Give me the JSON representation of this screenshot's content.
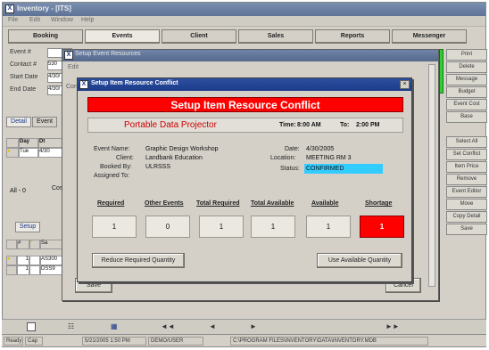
{
  "main_window": {
    "title": "Inventory - [ITS]",
    "menu": [
      "File",
      "Edit",
      "Window",
      "Help"
    ],
    "tabs": [
      "Booking",
      "Events",
      "Client",
      "Sales",
      "Reports",
      "Messenger"
    ],
    "active_tab": "Events",
    "fields": [
      {
        "label": "Event #",
        "value": ""
      },
      {
        "label": "Contact #",
        "value": "530"
      },
      {
        "label": "Start Date",
        "value": "4/30/"
      },
      {
        "label": "End Date",
        "value": "4/30/"
      }
    ],
    "side_buttons": [
      "Print",
      "Delete",
      "Message",
      "Budget",
      "Event Cost",
      "Base",
      "Select All",
      "Set Conflict",
      "Item Price",
      "Remove",
      "Event Editor",
      "Move",
      "Copy Detail",
      "Save"
    ],
    "subtabs": [
      "Detail",
      "Event"
    ],
    "active_subtab": "Detail",
    "grid_headers": [
      "Day",
      "Dt"
    ],
    "grid_rows": [
      [
        "Tue",
        "4/30"
      ]
    ],
    "lower_tab": "Setup",
    "lower_grid_headers": [
      "#",
      "*",
      "Sa"
    ],
    "lower_grid_rows": [
      [
        "1",
        "",
        "AS300"
      ],
      [
        "1",
        "",
        "DSS9"
      ]
    ],
    "side_label": "Cos",
    "left_label": "All - 0"
  },
  "background_dialog": {
    "title": "Setup Event Resources",
    "menu": "Edit",
    "left_label": "Conf"
  },
  "conflict_dialog": {
    "window_title": "Setup Item Resource Conflict",
    "header": "Setup Item Resource Conflict",
    "item_name": "Portable Data Projector",
    "time_label": "Time:",
    "time_from": "8:00 AM",
    "time_to_label": "To:",
    "time_to": "2:00 PM",
    "details_left": [
      {
        "label": "Event Name:",
        "value": "Graphic Design Workshop"
      },
      {
        "label": "Client:",
        "value": "Landbank Education"
      },
      {
        "label": "Booked By:",
        "value": "ULRSSS"
      },
      {
        "label": "Assigned To:",
        "value": ""
      }
    ],
    "details_right": [
      {
        "label": "Date:",
        "value": "4/30/2005"
      },
      {
        "label": "Location:",
        "value": "MEETING RM 3"
      },
      {
        "label": "Status:",
        "value": "CONFIRMED"
      }
    ],
    "columns": [
      "Required",
      "Other Events",
      "Total Required",
      "Total Available",
      "Available",
      "Shortage"
    ],
    "values": [
      "1",
      "0",
      "1",
      "1",
      "1",
      "1"
    ],
    "shortage_color": "#ff0000",
    "status_color": "#33ccff",
    "buttons": {
      "reduce": "Reduce Required Quantity",
      "use_available": "Use Available Quantity"
    }
  },
  "background_buttons": {
    "save": "Save",
    "cancel": "Cancel"
  },
  "navbar_glyphs": [
    "◄◄",
    "◄",
    "►",
    "►►"
  ],
  "statusbar": [
    "Ready",
    "Cap",
    "5/21/2005 1:50 PM",
    "DEMO/USER",
    "C:\\PROGRAM FILES\\INVENTORY\\DATA\\INVENTORY.MDB"
  ]
}
